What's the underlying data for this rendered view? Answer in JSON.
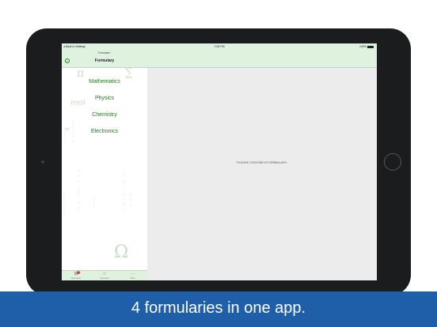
{
  "status_bar": {
    "back_label": "◂ Back to Settings",
    "time": "7:05 PM",
    "battery": "100%"
  },
  "sidebar": {
    "back_label": "Formulas ›",
    "title": "Formulary",
    "items": [
      {
        "label": "Mathematics"
      },
      {
        "label": "Physics"
      },
      {
        "label": "Chemistry"
      },
      {
        "label": "Electronics"
      }
    ],
    "decorations": {
      "pi": "π",
      "sigma": "∑",
      "mol": "mol",
      "omega": "Ω",
      "approx": "≈"
    }
  },
  "tab_bar": {
    "tabs": [
      {
        "label": "Favourites",
        "icon": "grid-icon",
        "glyph": "⊞",
        "badge": "1"
      },
      {
        "label": "Formulas",
        "icon": "star-icon",
        "glyph": "☆"
      },
      {
        "label": "More",
        "icon": "more-icon",
        "glyph": "···"
      }
    ]
  },
  "detail": {
    "placeholder": "PLEASE CHOOSE A FORMULARY."
  },
  "caption": {
    "text": "4 formularies in one app."
  },
  "colors": {
    "accent_green": "#1f7a1f",
    "nav_background": "#dff2df",
    "caption_band": "#1f5ea8",
    "badge": "#e0302a"
  }
}
